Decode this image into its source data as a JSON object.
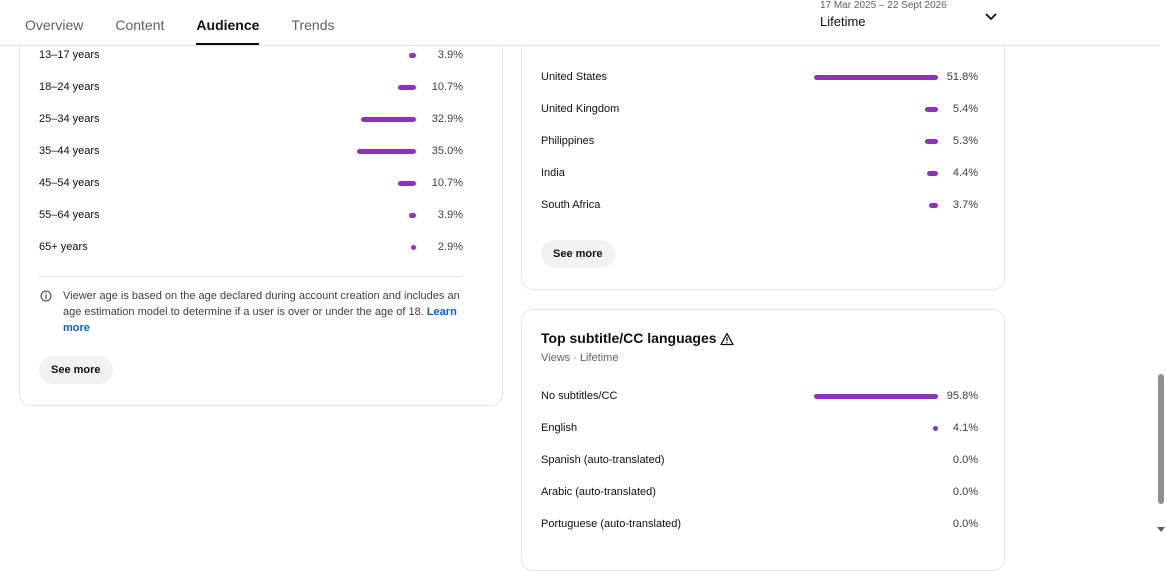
{
  "tabs": [
    {
      "label": "Overview"
    },
    {
      "label": "Content"
    },
    {
      "label": "Audience"
    },
    {
      "label": "Trends"
    }
  ],
  "active_tab": "Audience",
  "date_range": {
    "range": "17 Mar 2025 – 22 Sept 2026",
    "period": "Lifetime"
  },
  "age_card": {
    "rows": [
      {
        "label": "13–17 years",
        "percent_label": "3.9%",
        "value": 3.9
      },
      {
        "label": "18–24 years",
        "percent_label": "10.7%",
        "value": 10.7
      },
      {
        "label": "25–34 years",
        "percent_label": "32.9%",
        "value": 32.9
      },
      {
        "label": "35–44 years",
        "percent_label": "35.0%",
        "value": 35.0
      },
      {
        "label": "45–54 years",
        "percent_label": "10.7%",
        "value": 10.7
      },
      {
        "label": "55–64 years",
        "percent_label": "3.9%",
        "value": 3.9
      },
      {
        "label": "65+ years",
        "percent_label": "2.9%",
        "value": 2.9
      }
    ],
    "note_text": "Viewer age is based on the age declared during account creation and includes an age estimation model to determine if a user is over or under the age of 18.",
    "learn_more": "Learn more",
    "see_more": "See more"
  },
  "geography_card": {
    "rows": [
      {
        "label": "United States",
        "percent_label": "51.8%",
        "value": 51.8
      },
      {
        "label": "United Kingdom",
        "percent_label": "5.4%",
        "value": 5.4
      },
      {
        "label": "Philippines",
        "percent_label": "5.3%",
        "value": 5.3
      },
      {
        "label": "India",
        "percent_label": "4.4%",
        "value": 4.4
      },
      {
        "label": "South Africa",
        "percent_label": "3.7%",
        "value": 3.7
      }
    ],
    "see_more": "See more"
  },
  "subtitle_card": {
    "title": "Top subtitle/CC languages",
    "subtitle": "Views · Lifetime",
    "rows": [
      {
        "label": "No subtitles/CC",
        "percent_label": "95.8%",
        "value": 95.8
      },
      {
        "label": "English",
        "percent_label": "4.1%",
        "value": 4.1
      },
      {
        "label": "Spanish (auto-translated)",
        "percent_label": "0.0%",
        "value": 0.0
      },
      {
        "label": "Arabic (auto-translated)",
        "percent_label": "0.0%",
        "value": 0.0
      },
      {
        "label": "Portuguese (auto-translated)",
        "percent_label": "0.0%",
        "value": 0.0
      }
    ]
  },
  "colors": {
    "bar": "#8e32bb",
    "link": "#065fd4"
  }
}
